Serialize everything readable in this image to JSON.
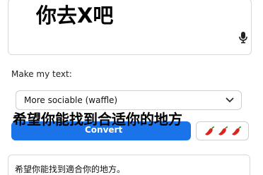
{
  "input": {
    "text": "你去X吧",
    "mic_icon": "microphone-icon"
  },
  "options": {
    "label": "Make my text:",
    "selected_style": "More sociable (waffle)",
    "chevron_icon": "chevron-down-icon"
  },
  "actions": {
    "convert_label": "Convert",
    "spice_icons": [
      "chili-pepper-icon",
      "chili-pepper-icon",
      "chili-pepper-icon"
    ],
    "accent_color": "#1a73e8"
  },
  "caption": {
    "text": "希望你能找到合适你的地方"
  },
  "output": {
    "text": "希望你能找到適合你的地方。"
  }
}
